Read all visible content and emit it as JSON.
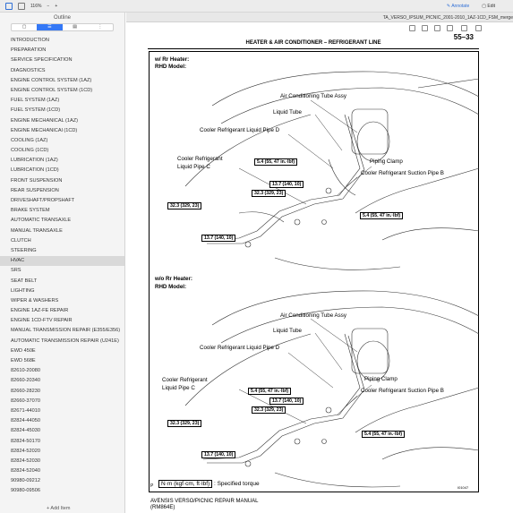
{
  "toolbar": {
    "zoom": "116%",
    "annotate_label": "Annotate",
    "edit_label": "Edit"
  },
  "document": {
    "title": "TA_VERSO_IPSUM_PICNIC_2001-2010_1AZ-1CD_FSM_merge"
  },
  "sidebar": {
    "title": "Outline",
    "add_item_label": "+ Add Item",
    "items": [
      {
        "label": "INTRODUCTION"
      },
      {
        "label": "PREPARATION"
      },
      {
        "label": "SERVICE SPECIFICATION"
      },
      {
        "label": "DIAGNOSTICS"
      },
      {
        "label": "ENGINE CONTROL SYSTEM (1AZ)"
      },
      {
        "label": "ENGINE CONTROL SYSTEM (1CD)"
      },
      {
        "label": "FUEL SYSTEM (1AZ)"
      },
      {
        "label": "FUEL SYSTEM (1CD)"
      },
      {
        "label": "ENGINE MECHANICAL (1AZ)"
      },
      {
        "label": "ENGINE MECHANICAl (1CD)"
      },
      {
        "label": "COOLING (1AZ)"
      },
      {
        "label": "COOLING (1CD)"
      },
      {
        "label": "LUBRICATION (1AZ)"
      },
      {
        "label": "LUBRICATION (1CD)"
      },
      {
        "label": "FRONT SUSPENSION"
      },
      {
        "label": "REAR SUSPENSION"
      },
      {
        "label": "DRIVESHAFT/PROPSHAFT"
      },
      {
        "label": "BRAKE SYSTEM"
      },
      {
        "label": "AUTOMATIC TRANSAXLE"
      },
      {
        "label": "MANUAL TRANSAXLE"
      },
      {
        "label": "CLUTCH"
      },
      {
        "label": "STEERING"
      },
      {
        "label": "HVAC"
      },
      {
        "label": "SRS"
      },
      {
        "label": "SEAT BELT"
      },
      {
        "label": "LIGHTING"
      },
      {
        "label": "WIPER & WASHERS"
      },
      {
        "label": "ENGINE 1AZ-FE REPAIR"
      },
      {
        "label": "ENGINE 1CD-FTV REPAIR"
      },
      {
        "label": "MANUAL TRANSMISSION REPAIR (E355/E356)"
      },
      {
        "label": "AUTOMATIC TRANSMISSION REPAIR (U241E)"
      },
      {
        "label": "EWD 450E"
      },
      {
        "label": "EWD 568E"
      },
      {
        "label": "82610-20080"
      },
      {
        "label": "82660-20340"
      },
      {
        "label": "82660-28230"
      },
      {
        "label": "82660-37070"
      },
      {
        "label": "82671-44010"
      },
      {
        "label": "82824-44050"
      },
      {
        "label": "82824-45030"
      },
      {
        "label": "82824-50170"
      },
      {
        "label": "82824-52020"
      },
      {
        "label": "82824-52030"
      },
      {
        "label": "82824-52040"
      },
      {
        "label": "90980-09212"
      },
      {
        "label": "90980-09506"
      }
    ],
    "selected_index": 22
  },
  "page": {
    "header": "HEATER & AIR CONDITIONER  –  REFRIGERANT LINE",
    "page_number": "55–33",
    "footer_line1": "AVENSIS VERSO/PICNIC REPAIR MANUAL",
    "footer_line2": "(RM864E)",
    "figure_code": "I01047",
    "legend_box": "N·m (kgf·cm, ft·lbf)",
    "legend_text": ": Specified torque",
    "side_marker": "P"
  },
  "diagram_top": {
    "heading1": "w/ Rr Heater:",
    "heading2": "RHD Model:",
    "labels": {
      "ac_tube": "Air Conditioning Tube Assy",
      "liquid_tube": "Liquid Tube",
      "pipe_d": "Cooler Refrigerant Liquid Pipe D",
      "pipe_c1": "Cooler Refrigerant",
      "pipe_c2": "Liquid Pipe C",
      "clamp": "Piping Clamp",
      "suction_b": "Cooler Refrigerant Suction Pipe B"
    },
    "torques": {
      "t1": "5.4 (55, 47 in.·lbf)",
      "t2": "13.7 (140, 10)",
      "t3": "32.3 (329, 23)",
      "t4": "32.3 (329, 23)",
      "t5": "5.4 (55, 47 in.·lbf)",
      "t6": "13.7 (140, 10)"
    }
  },
  "diagram_bottom": {
    "heading1": "w/o Rr Heater:",
    "heading2": "RHD Model:",
    "labels": {
      "ac_tube": "Air Conditioning Tube Assy",
      "liquid_tube": "Liquid Tube",
      "pipe_d": "Cooler Refrigerant Liquid Pipe D",
      "pipe_c1": "Cooler Refrigerant",
      "pipe_c2": "Liquid Pipe C",
      "clamp": "Piping Clamp",
      "suction_b": "Cooler Refrigerant Suction Pipe B"
    },
    "torques": {
      "t1": "5.4 (55, 47 in.·lbf)",
      "t2": "13.7 (140, 10)",
      "t3": "32.3 (329, 23)",
      "t4": "32.3 (329, 23)",
      "t5": "5.4 (55, 47 in.·lbf)",
      "t6": "13.7 (140, 10)"
    }
  }
}
